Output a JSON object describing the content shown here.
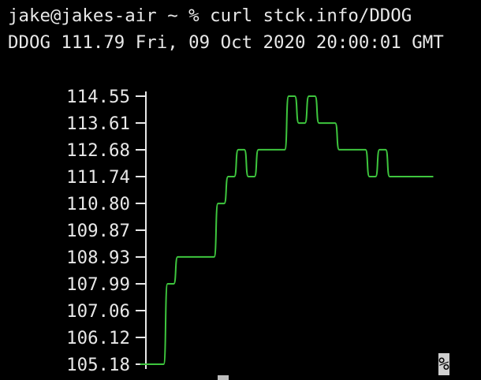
{
  "terminal": {
    "prompt": "jake@jakes-air ~ % curl stck.info/DDOG",
    "output": "DDOG 111.79 Fri, 09 Oct 2020 20:00:01 GMT",
    "end_prompt": "%"
  },
  "colors": {
    "background": "#000000",
    "text": "#e8e8e8",
    "line": "#3ec63e"
  },
  "chart_data": {
    "type": "line",
    "ticks": [
      "114.55",
      "113.61",
      "112.68",
      "111.74",
      "110.80",
      "109.87",
      "108.93",
      "107.99",
      "107.06",
      "106.12",
      "105.18"
    ],
    "ylim": [
      105.18,
      114.55
    ],
    "series": [
      {
        "values": [
          105.18,
          105.18,
          105.18,
          107.99,
          108.93,
          108.93,
          108.93,
          108.93,
          110.8,
          111.74,
          112.68,
          111.74,
          112.68,
          112.68,
          112.68,
          114.55,
          113.61,
          114.55,
          113.61,
          113.61,
          112.68,
          112.68,
          112.68,
          111.74,
          112.68,
          111.74,
          111.74,
          111.74,
          111.74,
          111.74
        ]
      }
    ]
  }
}
